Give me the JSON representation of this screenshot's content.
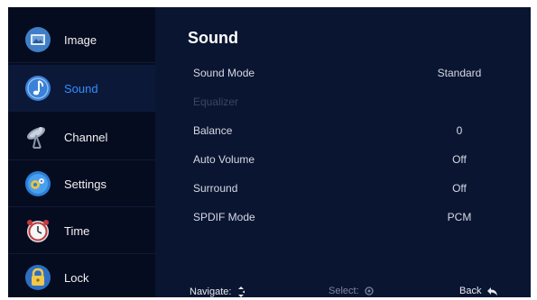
{
  "sidebar": {
    "items": [
      {
        "label": "Image"
      },
      {
        "label": "Sound"
      },
      {
        "label": "Channel"
      },
      {
        "label": "Settings"
      },
      {
        "label": "Time"
      },
      {
        "label": "Lock"
      }
    ]
  },
  "main": {
    "title": "Sound",
    "rows": [
      {
        "label": "Sound Mode",
        "value": "Standard"
      },
      {
        "label": "Equalizer",
        "value": ""
      },
      {
        "label": "Balance",
        "value": "0"
      },
      {
        "label": "Auto Volume",
        "value": "Off"
      },
      {
        "label": "Surround",
        "value": "Off"
      },
      {
        "label": "SPDIF Mode",
        "value": "PCM"
      }
    ]
  },
  "footer": {
    "navigate": "Navigate:",
    "select": "Select:",
    "back": "Back"
  },
  "colors": {
    "background": "#0a1532",
    "sidebar": "#060c20",
    "accent": "#2f8fff",
    "disabled": "#3b4663"
  },
  "icons": [
    "image-icon",
    "music-note-icon",
    "satellite-dish-icon",
    "gear-icon",
    "clock-icon",
    "padlock-icon"
  ]
}
